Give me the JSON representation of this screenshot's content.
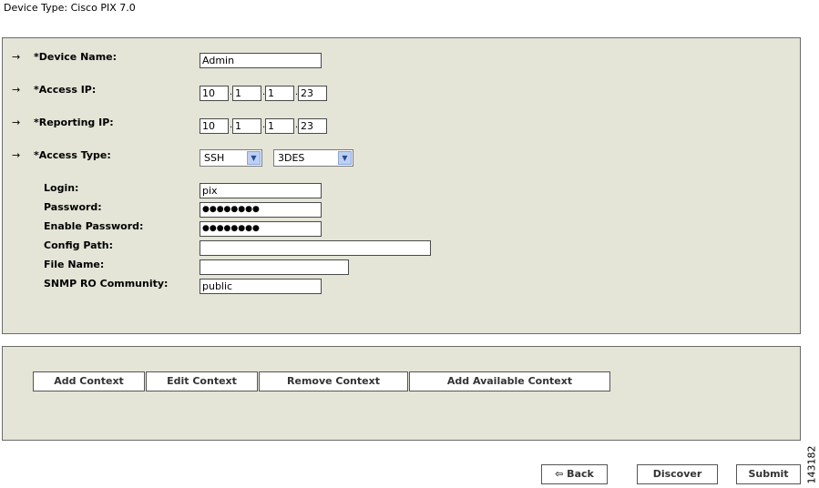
{
  "header": {
    "device_type": "Device Type:  Cisco PIX 7.0"
  },
  "form": {
    "arrow": "→",
    "device_name": {
      "label": "*Device Name:",
      "value": "Admin"
    },
    "access_ip": {
      "label": "*Access IP:",
      "octets": [
        "10",
        "1",
        "1",
        "23"
      ]
    },
    "reporting_ip": {
      "label": "*Reporting IP:",
      "octets": [
        "10",
        "1",
        "1",
        "23"
      ]
    },
    "ip_separator": ".",
    "access_type": {
      "label": "*Access Type:",
      "protocol": "SSH",
      "encryption": "3DES"
    },
    "login": {
      "label": "Login:",
      "value": "pix"
    },
    "password": {
      "label": "Password:",
      "value": "●●●●●●●●"
    },
    "enable_password": {
      "label": "Enable Password:",
      "value": "●●●●●●●●"
    },
    "config_path": {
      "label": "Config Path:",
      "value": ""
    },
    "file_name": {
      "label": "File Name:",
      "value": ""
    },
    "snmp_ro_community": {
      "label": "SNMP RO Community:",
      "value": "public"
    }
  },
  "context_buttons": {
    "add": "Add Context",
    "edit": "Edit Context",
    "remove": "Remove Context",
    "add_available": "Add Available Context"
  },
  "footer": {
    "back": "⇦ Back",
    "discover": "Discover",
    "submit": "Submit",
    "figure_id": "143182"
  },
  "icons": {
    "dropdown": "chevron-down-icon",
    "row_arrow": "arrow-right-icon"
  },
  "colors": {
    "panel_bg": "#e4e5d7",
    "dropdown_btn": "#bdd0f4"
  }
}
